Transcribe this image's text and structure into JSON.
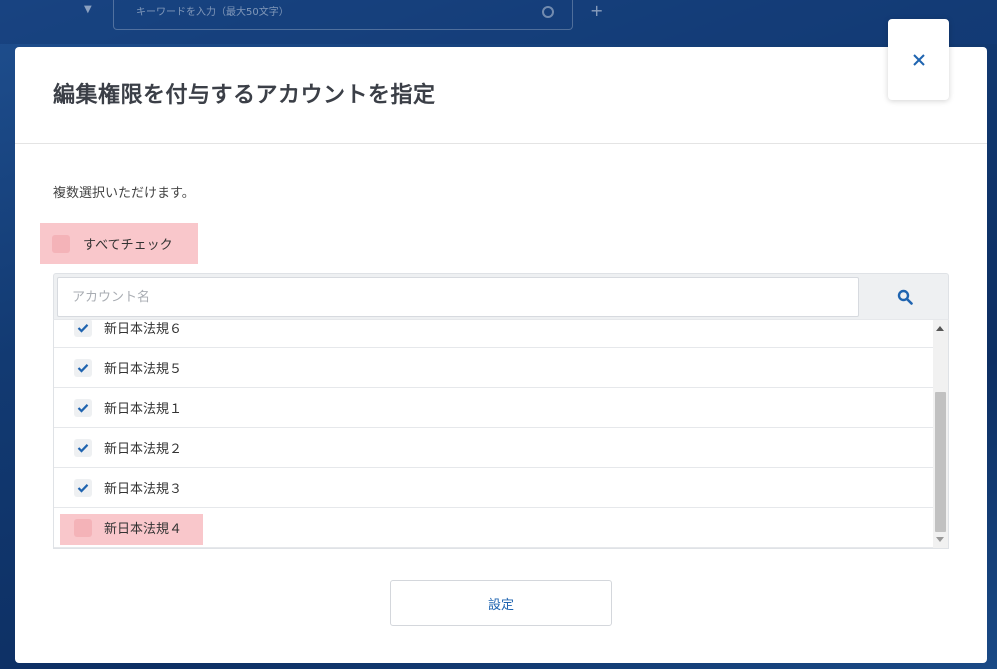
{
  "background": {
    "search_text": "キーワードを入力（最大50文字）"
  },
  "modal": {
    "title": "編集権限を付与するアカウントを指定",
    "description": "複数選択いただけます。",
    "check_all_label": "すべてチェック",
    "search_placeholder": "アカウント名",
    "accounts": [
      {
        "name": "新日本法規６",
        "checked": true
      },
      {
        "name": "新日本法規５",
        "checked": true
      },
      {
        "name": "新日本法規１",
        "checked": true
      },
      {
        "name": "新日本法規２",
        "checked": true
      },
      {
        "name": "新日本法規３",
        "checked": true
      },
      {
        "name": "新日本法規４",
        "checked": false
      }
    ],
    "submit_label": "設定"
  },
  "colors": {
    "accent": "#1f64b0",
    "highlight": "#f9c7cb",
    "title": "#3b3f47"
  },
  "icons": {
    "close": "close-icon",
    "search": "search-icon",
    "check": "check-icon"
  }
}
